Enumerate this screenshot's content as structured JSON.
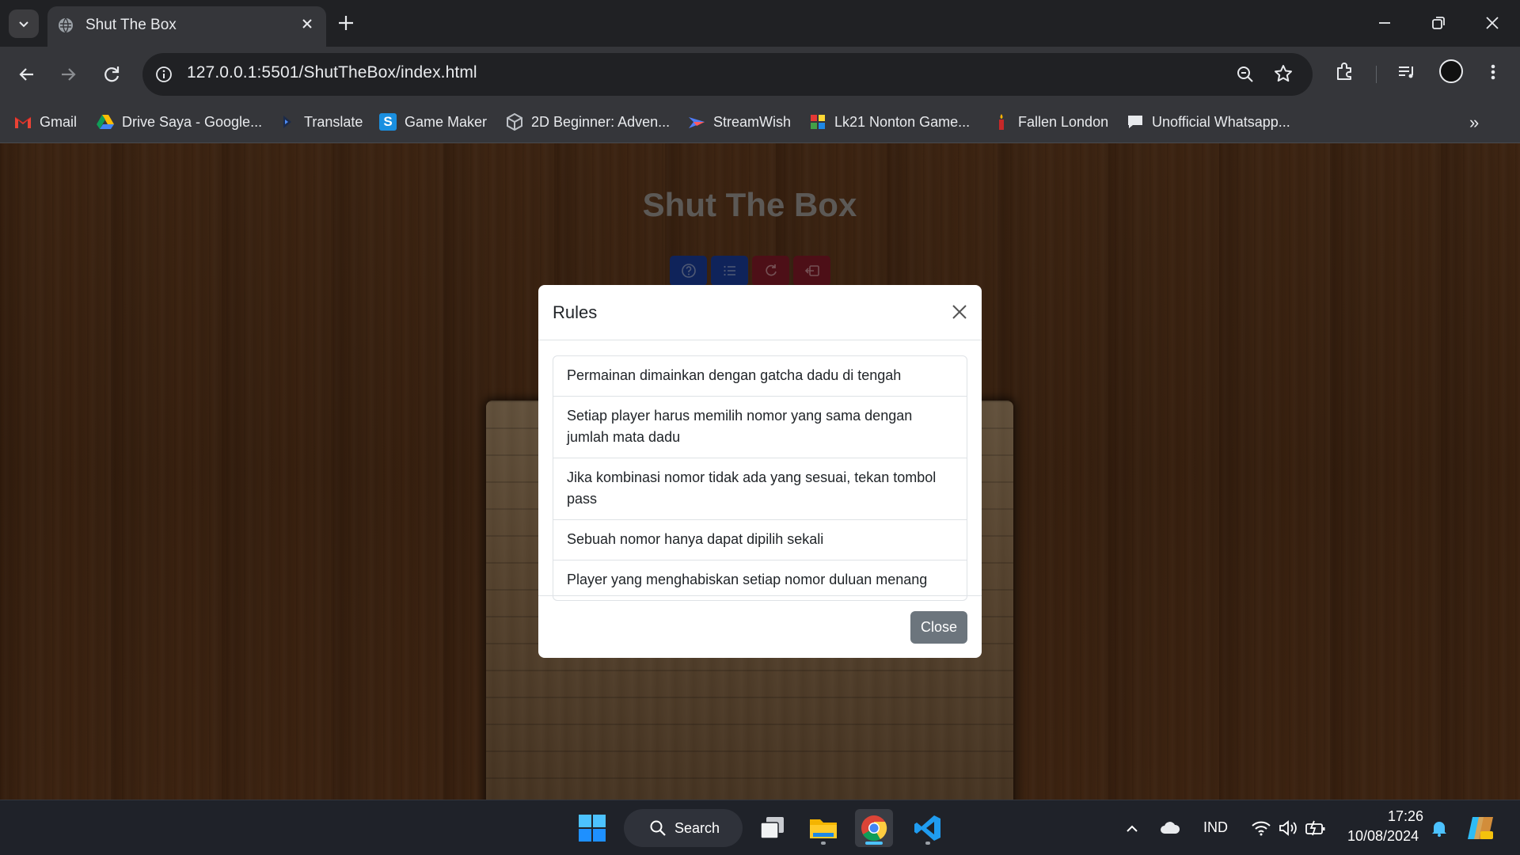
{
  "browser": {
    "tab_title": "Shut The Box",
    "url_host": "127.0.0.1",
    "url_rest": ":5501/ShutTheBox/index.html"
  },
  "bookmarks": [
    {
      "label": "Gmail",
      "icon": "gmail-icon"
    },
    {
      "label": "Drive Saya - Google...",
      "icon": "google-drive-icon"
    },
    {
      "label": "Translate",
      "icon": "translate-icon"
    },
    {
      "label": "Game Maker",
      "icon": "game-maker-icon"
    },
    {
      "label": "2D Beginner: Adven...",
      "icon": "unity-icon"
    },
    {
      "label": "StreamWish",
      "icon": "streamwish-icon"
    },
    {
      "label": "Lk21 Nonton Game...",
      "icon": "lk21-icon"
    },
    {
      "label": "Fallen London",
      "icon": "candle-icon"
    },
    {
      "label": "Unofficial Whatsapp...",
      "icon": "chat-icon"
    }
  ],
  "game": {
    "title": "Shut The Box",
    "buttons": [
      {
        "name": "rules-button",
        "icon": "question-icon",
        "color": "#1f47b5"
      },
      {
        "name": "history-button",
        "icon": "list-icon",
        "color": "#1f47b5"
      },
      {
        "name": "restart-button",
        "icon": "refresh-icon",
        "color": "#9a1f2e"
      },
      {
        "name": "exit-button",
        "icon": "exit-icon",
        "color": "#9a1f2e"
      }
    ]
  },
  "modal": {
    "title": "Rules",
    "rules": [
      "Permainan dimainkan dengan gatcha dadu di tengah",
      "Setiap player harus memilih nomor yang sama dengan jumlah mata dadu",
      "Jika kombinasi nomor tidak ada yang sesuai, tekan tombol pass",
      "Sebuah nomor hanya dapat dipilih sekali",
      "Player yang menghabiskan setiap nomor duluan menang"
    ],
    "close_label": "Close"
  },
  "taskbar": {
    "search_label": "Search",
    "language": "IND",
    "time": "17:26",
    "date": "10/08/2024"
  }
}
